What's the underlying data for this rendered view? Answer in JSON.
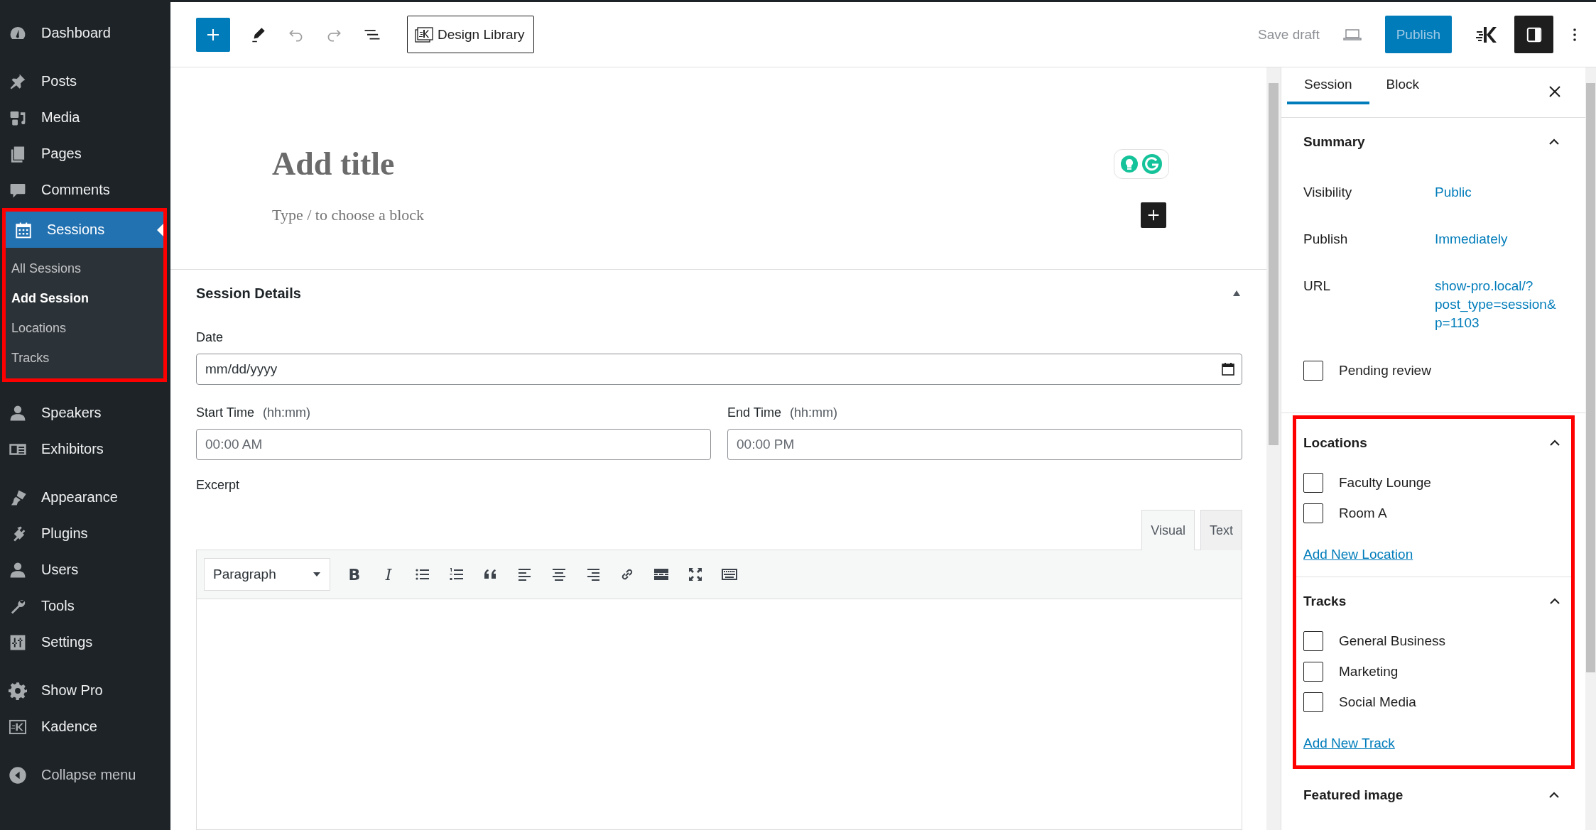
{
  "admin_menu": {
    "groups": [
      {
        "items": [
          {
            "label": "Dashboard",
            "selected": false
          }
        ]
      },
      {
        "items": [
          {
            "label": "Posts",
            "selected": false
          },
          {
            "label": "Media",
            "selected": false
          },
          {
            "label": "Pages",
            "selected": false
          },
          {
            "label": "Comments",
            "selected": false
          },
          {
            "label": "Sessions",
            "selected": true,
            "highlighted": true,
            "submenu": [
              {
                "label": "All Sessions",
                "selected": false
              },
              {
                "label": "Add Session",
                "selected": true
              },
              {
                "label": "Locations",
                "selected": false
              },
              {
                "label": "Tracks",
                "selected": false
              }
            ]
          }
        ]
      },
      {
        "items": [
          {
            "label": "Speakers",
            "selected": false
          },
          {
            "label": "Exhibitors",
            "selected": false
          }
        ]
      },
      {
        "items": [
          {
            "label": "Appearance",
            "selected": false
          },
          {
            "label": "Plugins",
            "selected": false
          },
          {
            "label": "Users",
            "selected": false
          },
          {
            "label": "Tools",
            "selected": false
          },
          {
            "label": "Settings",
            "selected": false
          }
        ]
      },
      {
        "items": [
          {
            "label": "Show Pro",
            "selected": false
          },
          {
            "label": "Kadence",
            "selected": false
          }
        ]
      }
    ],
    "collapse": {
      "label": "Collapse menu"
    }
  },
  "toolbar": {
    "undo": {
      "disabled": true
    },
    "redo": {
      "disabled": true
    },
    "design_library": {
      "label": "Design Library"
    },
    "save_draft": {
      "label": "Save draft",
      "disabled": true
    },
    "publish": {
      "label": "Publish",
      "disabled": true
    },
    "settings_toggle": {
      "pressed": true
    }
  },
  "editor": {
    "title_placeholder": "Add title",
    "block_placeholder": "Type / to choose a block"
  },
  "metabox": {
    "title": "Session Details",
    "expanded": true,
    "date": {
      "label": "Date",
      "placeholder": "mm/dd/yyyy"
    },
    "times": [
      {
        "label": "Start Time",
        "hint": "(hh:mm)",
        "placeholder": "00:00 AM"
      },
      {
        "label": "End Time",
        "hint": "(hh:mm)",
        "placeholder": "00:00 PM"
      }
    ],
    "excerpt": {
      "label": "Excerpt",
      "tabs": [
        {
          "label": "Visual",
          "selected": true
        },
        {
          "label": "Text",
          "selected": false
        }
      ],
      "format": "Paragraph",
      "text_tools": [
        {
          "kind": "bold",
          "label": "B"
        },
        {
          "kind": "italic",
          "label": "I"
        }
      ]
    }
  },
  "settings_sidebar": {
    "tabs": [
      {
        "label": "Session",
        "selected": true
      },
      {
        "label": "Block",
        "selected": false
      }
    ],
    "panels": [
      {
        "title": "Summary",
        "expanded": true,
        "rows": [
          {
            "label": "Visibility",
            "value": "Public"
          },
          {
            "label": "Publish",
            "value": "Immediately"
          },
          {
            "label": "URL",
            "value": "show-pro.local/?post_type=session&p=1103"
          }
        ],
        "options": [
          {
            "label": "Pending review",
            "checked": false
          }
        ]
      },
      {
        "title": "Locations",
        "expanded": true,
        "highlighted": true,
        "options": [
          {
            "label": "Faculty Lounge",
            "checked": false
          },
          {
            "label": "Room A",
            "checked": false
          }
        ],
        "link": "Add New Location"
      },
      {
        "title": "Tracks",
        "expanded": true,
        "highlighted": true,
        "options": [
          {
            "label": "General Business",
            "checked": false
          },
          {
            "label": "Marketing",
            "checked": false
          },
          {
            "label": "Social Media",
            "checked": false
          }
        ],
        "link": "Add New Track"
      },
      {
        "title": "Featured image",
        "expanded": true
      }
    ]
  }
}
